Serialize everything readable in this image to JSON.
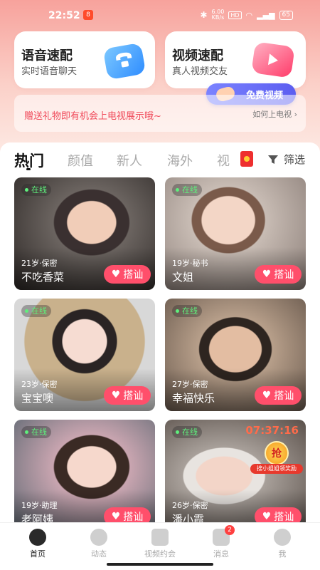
{
  "status_bar": {
    "time": "22:52",
    "app_badge": "8",
    "speed_value": "6.00",
    "speed_unit": "KB/s",
    "hd": "HD",
    "battery": "65"
  },
  "quick_match": {
    "voice": {
      "title": "语音速配",
      "subtitle": "实时语音聊天"
    },
    "video": {
      "title": "视频速配",
      "subtitle": "真人视频交友"
    },
    "free_video_label": "免费视频"
  },
  "gift_banner": {
    "text": "赠送礼物即有机会上电视展示哦~",
    "link": "如何上电视"
  },
  "tabs": [
    {
      "label": "热门"
    },
    {
      "label": "颜值"
    },
    {
      "label": "新人"
    },
    {
      "label": "海外"
    },
    {
      "label": "视"
    }
  ],
  "filter_label": "筛选",
  "online_label": "在线",
  "chat_label": "搭讪",
  "cards": [
    {
      "meta": "21岁·保密",
      "name": "不吃香菜",
      "online": true
    },
    {
      "meta": "19岁·秘书",
      "name": "文姐",
      "online": true
    },
    {
      "meta": "23岁·保密",
      "name": "宝宝噢",
      "online": true
    },
    {
      "meta": "27岁·保密",
      "name": "幸福快乐",
      "online": true
    },
    {
      "meta": "19岁·助理",
      "name": "老阿姨",
      "online": true
    },
    {
      "meta": "26岁·保密",
      "name": "潘小霞",
      "online": true,
      "timer": "07:37:16",
      "rob_label": "抢",
      "rob_text": "搜小姐姐领奖励"
    }
  ],
  "bottom_nav": [
    {
      "label": "首页",
      "icon": "home-icon"
    },
    {
      "label": "动态",
      "icon": "moments-icon"
    },
    {
      "label": "视频约会",
      "icon": "video-date-icon"
    },
    {
      "label": "消息",
      "icon": "message-icon",
      "badge": "2"
    },
    {
      "label": "我",
      "icon": "profile-icon"
    }
  ],
  "colors": {
    "accent": "#ff4f6b",
    "online": "#5ef07c",
    "banner_text": "#f04a5a",
    "free_video": "#6a6ff5"
  }
}
